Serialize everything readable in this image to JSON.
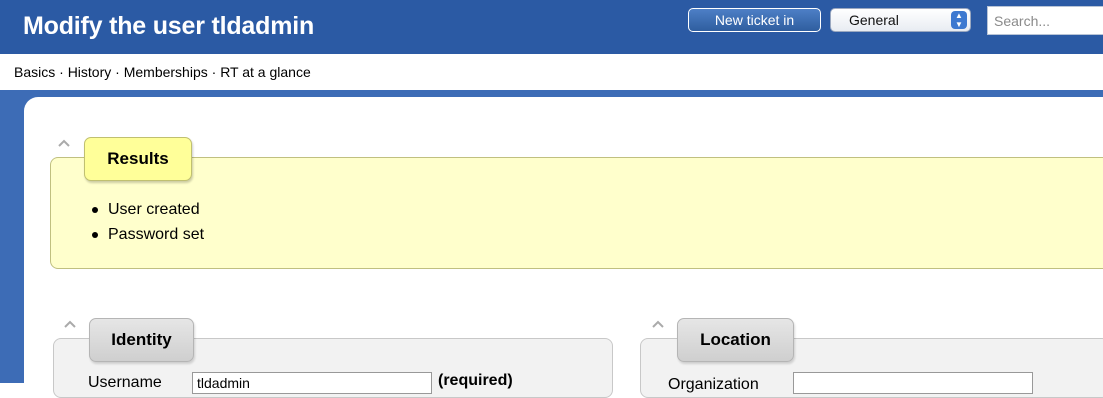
{
  "header": {
    "title": "Modify the user tldadmin",
    "new_ticket_label": "New ticket in",
    "queue_selected": "General",
    "search_placeholder": "Search..."
  },
  "subnav": {
    "items": [
      "Basics",
      "History",
      "Memberships",
      "RT at a glance"
    ],
    "separator": " · "
  },
  "results": {
    "heading": "Results",
    "messages": [
      "User created",
      "Password set"
    ]
  },
  "identity": {
    "heading": "Identity",
    "username_label": "Username",
    "username_value": "tldadmin",
    "required_note": "(required)"
  },
  "location": {
    "heading": "Location",
    "organization_label": "Organization",
    "organization_value": ""
  },
  "colors": {
    "header_bg": "#2b5aa4",
    "frame_bg": "#3d6cb6",
    "results_bg": "#ffffcc",
    "results_tab_bg": "#ffff99",
    "panel_bg": "#f2f2f2"
  },
  "icons": {
    "collapse": "chevron-up-icon",
    "select_arrows": "updown-arrows-icon"
  }
}
